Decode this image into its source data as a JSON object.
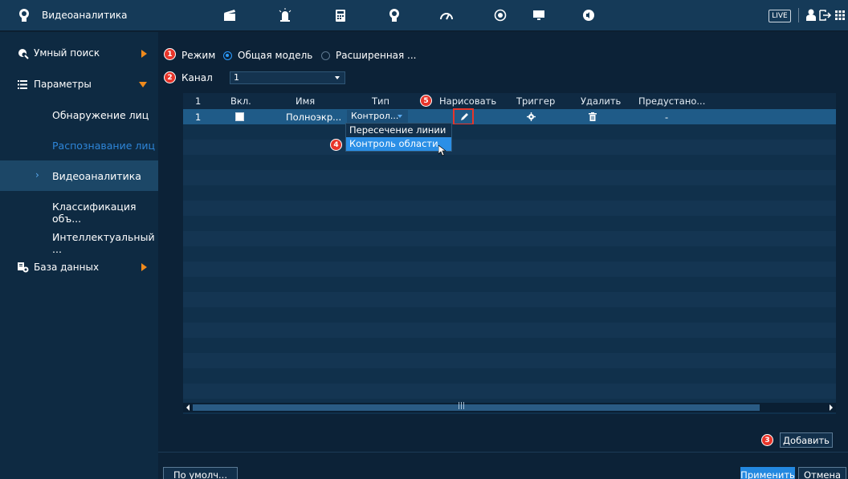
{
  "header": {
    "title": "Видеоаналитика",
    "live_label": "LIVE",
    "icons": [
      "clapper-icon",
      "alarm-light-icon",
      "calculator-icon",
      "face-ai-icon",
      "speedometer-icon",
      "record-icon",
      "monitor-icon",
      "speaker-icon"
    ]
  },
  "sidebar": {
    "items": [
      {
        "label": "Умный поиск"
      },
      {
        "label": "Параметры"
      },
      {
        "label": "Обнаружение лиц"
      },
      {
        "label": "Распознавание лиц"
      },
      {
        "label": "Видеоаналитика"
      },
      {
        "label": "Классификация объ..."
      },
      {
        "label": "Интеллектуальный ..."
      },
      {
        "label": "База данных"
      }
    ],
    "active_marker": "›"
  },
  "annotations": {
    "b1": "1",
    "b2": "2",
    "b3": "3",
    "b4": "4",
    "b5": "5"
  },
  "mode": {
    "label": "Режим",
    "option1": "Общая модель",
    "option2": "Расширенная ...",
    "selected": "Общая модель"
  },
  "channel": {
    "label": "Канал",
    "value": "1"
  },
  "table": {
    "columns": [
      "",
      "Вкл.",
      "Имя",
      "Тип",
      "Нарисовать",
      "Триггер",
      "Удалить",
      "Предустано..."
    ],
    "first_col_header": "1",
    "rows": [
      {
        "num": "1",
        "enabled": false,
        "name": "Полноэкр...",
        "type": "Контрол...",
        "preset": "-"
      }
    ]
  },
  "type_dropdown": {
    "options": [
      "Пересечение линии",
      "Контроль области"
    ],
    "highlighted": "Контроль области"
  },
  "buttons": {
    "add": "Добавить",
    "default": "По умолч...",
    "apply": "Применить",
    "cancel": "Отмена"
  },
  "scroll_mid": "|||",
  "colors": {
    "accent": "#2388e0",
    "badge": "#e8352a",
    "arrow": "#f08a1c",
    "selected_row": "#1f5b88"
  }
}
